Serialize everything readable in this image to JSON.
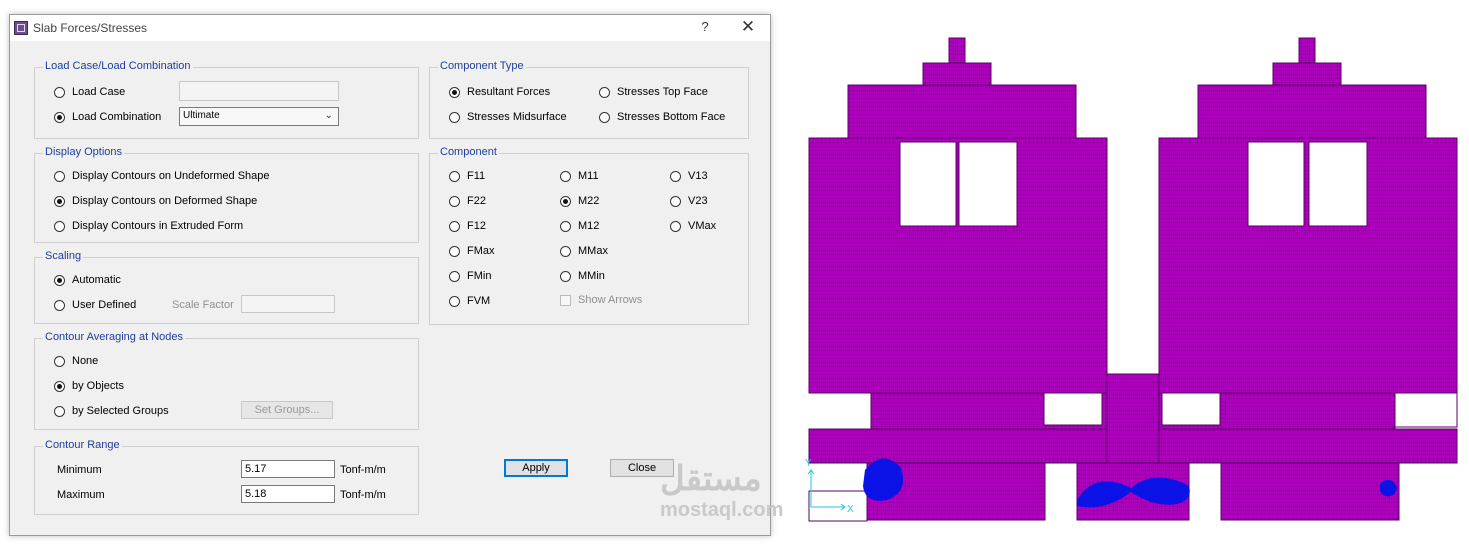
{
  "dialog": {
    "title": "Slab Forces/Stresses",
    "help": "?",
    "close": "✕"
  },
  "load_case": {
    "label": "Load Case/Load Combination",
    "options": [
      {
        "label": "Load Case",
        "selected": false
      },
      {
        "label": "Load Combination",
        "selected": true
      }
    ],
    "load_case_value": "",
    "combination_value": "Ultimate"
  },
  "display_options": {
    "label": "Display Options",
    "options": [
      {
        "label": "Display Contours on Undeformed Shape",
        "selected": false
      },
      {
        "label": "Display Contours on Deformed Shape",
        "selected": true
      },
      {
        "label": "Display Contours in Extruded Form",
        "selected": false
      }
    ]
  },
  "scaling": {
    "label": "Scaling",
    "options": [
      {
        "label": "Automatic",
        "selected": true
      },
      {
        "label": "User Defined",
        "selected": false
      }
    ],
    "scale_factor_label": "Scale Factor",
    "scale_factor_value": ""
  },
  "averaging": {
    "label": "Contour Averaging at Nodes",
    "options": [
      {
        "label": "None",
        "selected": false
      },
      {
        "label": "by Objects",
        "selected": true
      },
      {
        "label": "by Selected Groups",
        "selected": false
      }
    ],
    "set_groups": "Set Groups..."
  },
  "contour_range": {
    "label": "Contour Range",
    "min_label": "Minimum",
    "min_value": "5.17",
    "max_label": "Maximum",
    "max_value": "5.18",
    "unit": "Tonf-m/m"
  },
  "component_type": {
    "label": "Component Type",
    "options": [
      {
        "label": "Resultant Forces",
        "selected": true
      },
      {
        "label": "Stresses Top Face",
        "selected": false
      },
      {
        "label": "Stresses Midsurface",
        "selected": false
      },
      {
        "label": "Stresses Bottom Face",
        "selected": false
      }
    ]
  },
  "component": {
    "label": "Component",
    "col1": [
      {
        "label": "F11",
        "selected": false
      },
      {
        "label": "F22",
        "selected": false
      },
      {
        "label": "F12",
        "selected": false
      },
      {
        "label": "FMax",
        "selected": false
      },
      {
        "label": "FMin",
        "selected": false
      },
      {
        "label": "FVM",
        "selected": false
      }
    ],
    "col2": [
      {
        "label": "M11",
        "selected": false
      },
      {
        "label": "M22",
        "selected": true
      },
      {
        "label": "M12",
        "selected": false
      },
      {
        "label": "MMax",
        "selected": false
      },
      {
        "label": "MMin",
        "selected": false
      }
    ],
    "col3": [
      {
        "label": "V13",
        "selected": false
      },
      {
        "label": "V23",
        "selected": false
      },
      {
        "label": "VMax",
        "selected": false
      }
    ],
    "show_arrows": "Show Arrows"
  },
  "buttons": {
    "apply": "Apply",
    "close": "Close"
  },
  "model_view": {
    "axis_x": "X",
    "axis_y": "Y",
    "slab_color": "#b000c0",
    "contour_color": "#0a12e6",
    "axis_color": "#22c4e0"
  },
  "watermark": {
    "arabic": "مستقل",
    "latin": "mostaql.com"
  }
}
